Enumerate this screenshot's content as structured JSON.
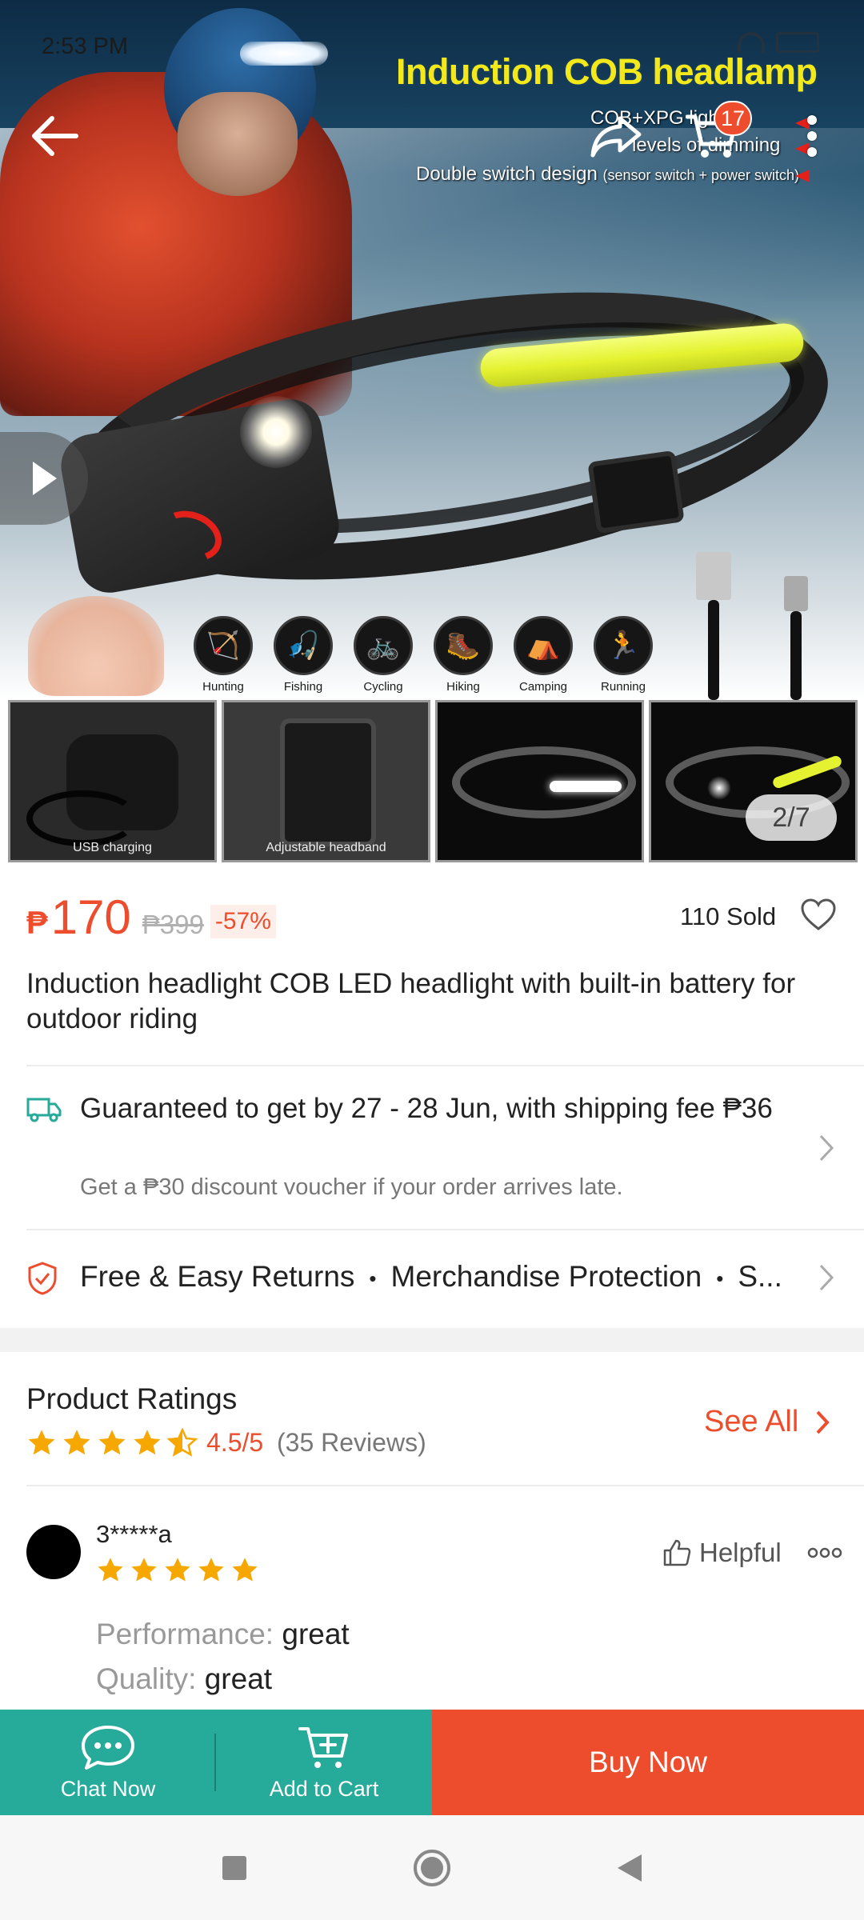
{
  "status_bar": {
    "time": "2:53 PM"
  },
  "hero": {
    "title": "Induction COB headlamp",
    "sub1": "COB+XPG lights",
    "sub2": "levels of dimming",
    "sub3_main": "Double switch design ",
    "sub3_small": "(sensor switch + power switch)",
    "activities": [
      "Hunting",
      "Fishing",
      "Cycling",
      "Hiking",
      "Camping",
      "Running"
    ],
    "activity_icons": [
      "archer-icon",
      "fisher-icon",
      "cyclist-icon",
      "hiker-icon",
      "tent-icon",
      "runner-icon"
    ],
    "cart_count": "17"
  },
  "thumbnails": [
    {
      "caption": "USB charging"
    },
    {
      "caption": "Adjustable headband"
    },
    {
      "caption": ""
    },
    {
      "caption": ""
    }
  ],
  "image_counter": "2/7",
  "product": {
    "currency": "₱",
    "price": "170",
    "original_price": "₱399",
    "discount": "-57%",
    "sold": "110 Sold",
    "title": "Induction headlight COB LED headlight with built-in battery for outdoor riding"
  },
  "shipping": {
    "main": "Guaranteed to get by 27 - 28 Jun, with shipping fee ₱36",
    "sub": "Get a ₱30 discount voucher if your order arrives late."
  },
  "returns": {
    "item1": "Free & Easy Returns",
    "item2": "Merchandise Protection",
    "item3": "S...",
    "separator": "•"
  },
  "ratings": {
    "title": "Product Ratings",
    "score": "4.5/5",
    "count": "(35 Reviews)",
    "see_all": "See All",
    "stars": 4.5
  },
  "review": {
    "user": "3*****a",
    "stars": 5,
    "helpful": "Helpful",
    "performance_label": "Performance:",
    "performance_value": "great",
    "quality_label": "Quality:",
    "quality_value": "great"
  },
  "bottom_bar": {
    "chat": "Chat Now",
    "add_to_cart": "Add to Cart",
    "buy_now": "Buy Now"
  },
  "colors": {
    "brand": "#ee4d2d",
    "teal": "#26aa99",
    "star": "#f6a700"
  }
}
